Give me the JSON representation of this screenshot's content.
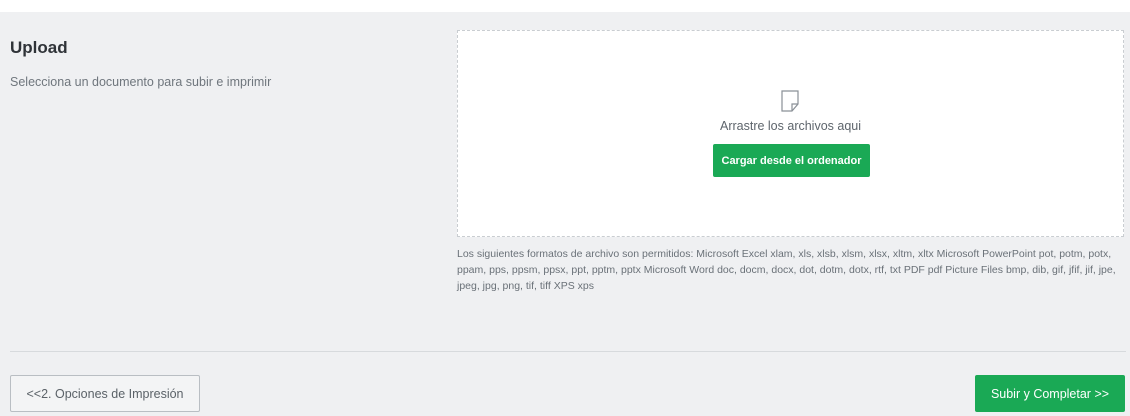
{
  "upload": {
    "title": "Upload",
    "subtitle": "Selecciona un documento para subir e imprimir",
    "dropzone": {
      "icon": "file-icon",
      "text": "Arrastre los archivos aqui",
      "button_label": "Cargar desde el ordenador"
    },
    "allowed_formats": "Los siguientes formatos de archivo son permitidos: Microsoft Excel xlam, xls, xlsb, xlsm, xlsx, xltm, xltx Microsoft PowerPoint pot, potm, potx, ppam, pps, ppsm, ppsx, ppt, pptm, pptx Microsoft Word doc, docm, docx, dot, dotm, dotx, rtf, txt PDF pdf Picture Files bmp, dib, gif, jfif, jif, jpe, jpeg, jpg, png, tif, tiff XPS xps"
  },
  "footer": {
    "back_label": "<<2. Opciones de Impresión",
    "next_label": "Subir y Completar >>"
  },
  "colors": {
    "accent_green": "#1aa955",
    "panel_bg": "#eff0f2"
  }
}
